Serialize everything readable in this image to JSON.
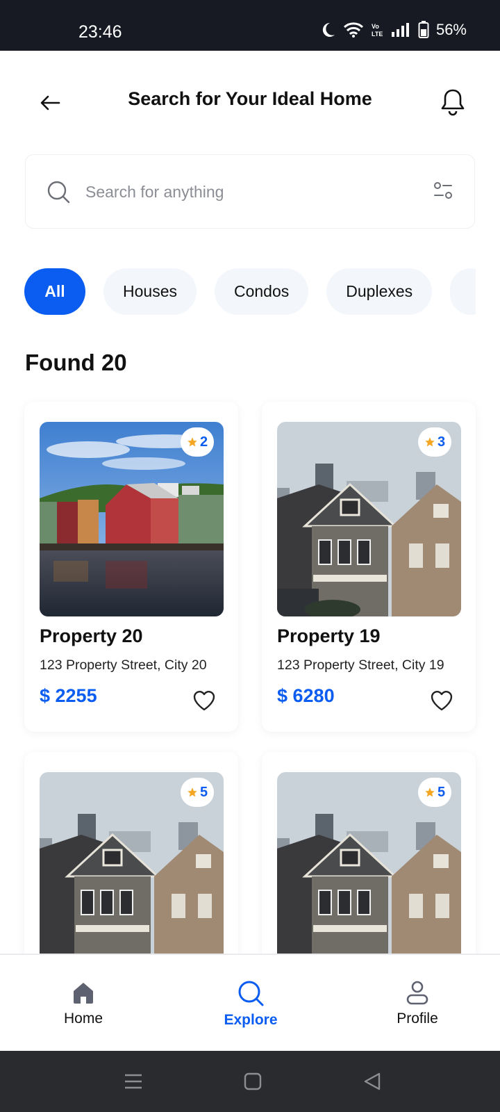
{
  "status_bar": {
    "time": "23:46",
    "battery": "56%"
  },
  "header": {
    "title": "Search for Your Ideal Home"
  },
  "search": {
    "placeholder": "Search for anything",
    "value": ""
  },
  "chips": [
    {
      "label": "All",
      "active": true
    },
    {
      "label": "Houses",
      "active": false
    },
    {
      "label": "Condos",
      "active": false
    },
    {
      "label": "Duplexes",
      "active": false
    }
  ],
  "results": {
    "title": "Found 20"
  },
  "properties": [
    {
      "title": "Property 20",
      "address": "123 Property Street, City 20",
      "price": "$ 2255",
      "rating": "2",
      "image": "waterfront-houses"
    },
    {
      "title": "Property 19",
      "address": "123 Property Street, City 19",
      "price": "$ 6280",
      "rating": "3",
      "image": "victorian-houses"
    },
    {
      "title": "",
      "address": "",
      "price": "",
      "rating": "5",
      "image": "victorian-houses"
    },
    {
      "title": "",
      "address": "",
      "price": "",
      "rating": "5",
      "image": "victorian-houses"
    }
  ],
  "bottom_nav": [
    {
      "label": "Home",
      "icon": "home-icon",
      "active": false
    },
    {
      "label": "Explore",
      "icon": "search-icon",
      "active": true
    },
    {
      "label": "Profile",
      "icon": "profile-icon",
      "active": false
    }
  ],
  "colors": {
    "accent": "#0b5cf0",
    "status_bar": "#171a23",
    "star": "#f5a623",
    "chip_bg": "#f3f6fb"
  }
}
